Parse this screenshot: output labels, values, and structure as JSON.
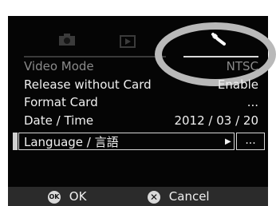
{
  "tabs": [
    {
      "name": "camera",
      "icon": "camera-icon"
    },
    {
      "name": "playback",
      "icon": "play-icon"
    },
    {
      "name": "setup",
      "icon": "wrench-icon",
      "active": true
    }
  ],
  "menu": {
    "items": [
      {
        "label": "Video Mode",
        "value": "NTSC"
      },
      {
        "label": "Release without Card",
        "value": "Enable"
      },
      {
        "label": "Format Card",
        "value": "..."
      },
      {
        "label": "Date / Time",
        "value": "2012 / 03 / 20"
      },
      {
        "label": "Language / 言語",
        "value": "..."
      }
    ]
  },
  "footer": {
    "ok_icon": "OK",
    "ok_label": "OK",
    "cancel_label": "Cancel"
  },
  "colors": {
    "screen_bg": "#050505",
    "text": "#f0f0f0",
    "highlight_ring": "#b9b9b9"
  }
}
